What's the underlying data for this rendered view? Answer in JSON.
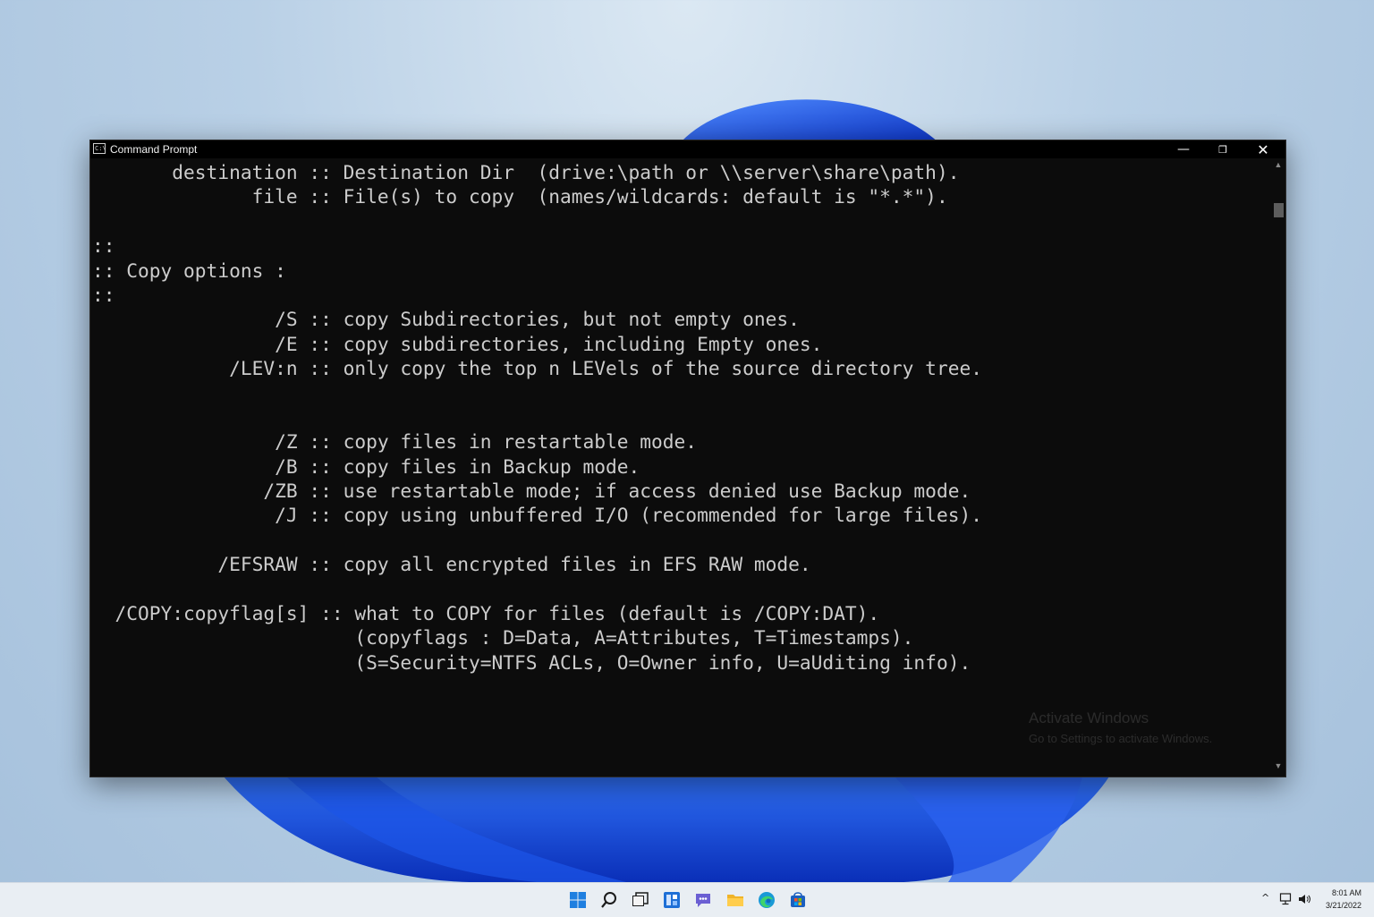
{
  "window": {
    "title": "Command Prompt",
    "icon_text": "C:\\",
    "minimize_symbol": "—",
    "maximize_symbol": "❐",
    "close_symbol": "✕"
  },
  "console_lines": [
    "       destination :: Destination Dir  (drive:\\path or \\\\server\\share\\path).",
    "              file :: File(s) to copy  (names/wildcards: default is \"*.*\").",
    "",
    "::",
    ":: Copy options :",
    "::",
    "                /S :: copy Subdirectories, but not empty ones.",
    "                /E :: copy subdirectories, including Empty ones.",
    "            /LEV:n :: only copy the top n LEVels of the source directory tree.",
    "",
    "",
    "                /Z :: copy files in restartable mode.",
    "                /B :: copy files in Backup mode.",
    "               /ZB :: use restartable mode; if access denied use Backup mode.",
    "                /J :: copy using unbuffered I/O (recommended for large files).",
    "",
    "           /EFSRAW :: copy all encrypted files in EFS RAW mode.",
    "",
    "  /COPY:copyflag[s] :: what to COPY for files (default is /COPY:DAT).",
    "                       (copyflags : D=Data, A=Attributes, T=Timestamps).",
    "                       (S=Security=NTFS ACLs, O=Owner info, U=aUditing info)."
  ],
  "scrollbar": {
    "up_arrow": "▲",
    "down_arrow": "▼"
  },
  "watermark": {
    "line1": "Activate Windows",
    "line2": "Go to Settings to activate Windows."
  },
  "taskbar": {
    "icons": [
      "windows-start-icon",
      "search-icon",
      "task-view-icon",
      "widgets-icon",
      "teams-chat-icon",
      "file-explorer-icon",
      "edge-browser-icon",
      "microsoft-store-icon"
    ],
    "tray": {
      "chevron": "^",
      "time": "8:01 AM",
      "date": "3/21/2022"
    }
  },
  "colors": {
    "console_bg": "#0c0c0c",
    "console_text": "#cccccc",
    "taskbar_bg": "#e9eef3",
    "bloom": "#1a4fd6"
  }
}
